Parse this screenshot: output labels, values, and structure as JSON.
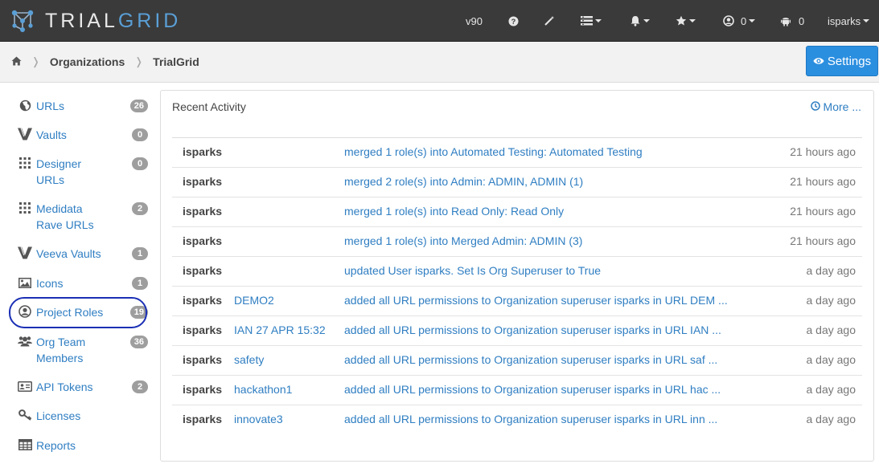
{
  "brand": {
    "name_part1": "TRIAL",
    "name_part2": "GRID"
  },
  "navbar": {
    "version": "v90",
    "help_icon": "question-circle-icon",
    "magic_icon": "magic-wand-icon",
    "list_icon": "list-menu-icon",
    "bell_icon": "bell-icon",
    "star_icon": "star-icon",
    "user_count": "0",
    "android_count": "0",
    "user_name": "isparks"
  },
  "breadcrumb": {
    "home_icon": "home-icon",
    "items": [
      "Organizations",
      "TrialGrid"
    ]
  },
  "settings_button": {
    "label": "Settings",
    "icon": "eye-icon",
    "color": "#2b8fe0"
  },
  "sidebar": {
    "items": [
      {
        "label": "URLs",
        "badge": "26",
        "icon": "globe-icon"
      },
      {
        "label": "Vaults",
        "badge": "0",
        "icon": "vault-v-icon"
      },
      {
        "label": "Designer URLs",
        "badge": "0",
        "icon": "grid-dots-icon"
      },
      {
        "label": "Medidata Rave URLs",
        "badge": "2",
        "icon": "grid-dots-icon"
      },
      {
        "label": "Veeva Vaults",
        "badge": "1",
        "icon": "vault-v-icon"
      },
      {
        "label": "Icons",
        "badge": "1",
        "icon": "image-icon"
      },
      {
        "label": "Project Roles",
        "badge": "19",
        "icon": "user-circle-icon"
      },
      {
        "label": "Org Team Members",
        "badge": "36",
        "icon": "users-icon"
      },
      {
        "label": "API Tokens",
        "badge": "2",
        "icon": "id-card-icon"
      },
      {
        "label": "Licenses",
        "badge": "",
        "icon": "key-icon"
      },
      {
        "label": "Reports",
        "badge": "",
        "icon": "table-icon"
      }
    ]
  },
  "activity": {
    "title": "Recent Activity",
    "more_label": "More ...",
    "rows": [
      {
        "user": "isparks",
        "url": "",
        "action": "merged 1 role(s) into Automated Testing: Automated Testing",
        "time": "21 hours ago"
      },
      {
        "user": "isparks",
        "url": "",
        "action": "merged 2 role(s) into Admin: ADMIN, ADMIN (1)",
        "time": "21 hours ago"
      },
      {
        "user": "isparks",
        "url": "",
        "action": "merged 1 role(s) into Read Only: Read Only",
        "time": "21 hours ago"
      },
      {
        "user": "isparks",
        "url": "",
        "action": "merged 1 role(s) into Merged Admin: ADMIN (3)",
        "time": "21 hours ago"
      },
      {
        "user": "isparks",
        "url": "",
        "action": "updated User isparks. Set Is Org Superuser to True",
        "time": "a day ago"
      },
      {
        "user": "isparks",
        "url": "DEMO2",
        "action": "added all URL permissions to Organization superuser isparks in URL DEM ...",
        "time": "a day ago"
      },
      {
        "user": "isparks",
        "url": "IAN 27 APR 15:32",
        "action": "added all URL permissions to Organization superuser isparks in URL IAN ...",
        "time": "a day ago"
      },
      {
        "user": "isparks",
        "url": "safety",
        "action": "added all URL permissions to Organization superuser isparks in URL saf ...",
        "time": "a day ago"
      },
      {
        "user": "isparks",
        "url": "hackathon1",
        "action": "added all URL permissions to Organization superuser isparks in URL hac ...",
        "time": "a day ago"
      },
      {
        "user": "isparks",
        "url": "innovate3",
        "action": "added all URL permissions to Organization superuser isparks in URL inn ...",
        "time": "a day ago"
      }
    ]
  }
}
